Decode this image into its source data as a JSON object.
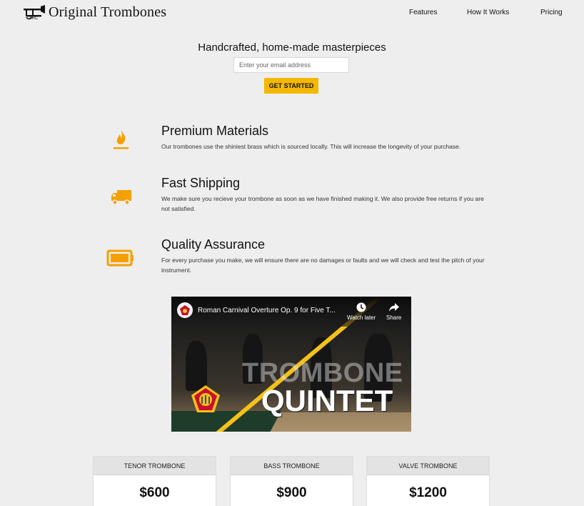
{
  "brand": {
    "name": "Original Trombones",
    "logo_icon": "trombone-icon"
  },
  "nav": {
    "features": "Features",
    "how": "How It Works",
    "pricing": "Pricing"
  },
  "hero": {
    "title": "Handcrafted, home-made masterpieces",
    "email_placeholder": "Enter your email address",
    "cta": "GET STARTED"
  },
  "features": [
    {
      "icon": "fire-icon",
      "title": "Premium Materials",
      "desc": "Our trombones use the shiniest brass which is sourced locally. This will increase the longevity of your purchase."
    },
    {
      "icon": "truck-icon",
      "title": "Fast Shipping",
      "desc": "We make sure you recieve your trombone as soon as we have finished making it. We also provide free returns if you are not satisfied."
    },
    {
      "icon": "battery-icon",
      "title": "Quality Assurance",
      "desc": "For every purchase you make, we will ensure there are no damages or faults and we will check and test the pitch of your instrument."
    }
  ],
  "video": {
    "title": "Roman Carnival Overture Op. 9 for Five T...",
    "watch_later": "Watch later",
    "share": "Share",
    "overlay_top": "TROMBONE",
    "overlay_bottom": "QUINTET"
  },
  "pricing": [
    {
      "name": "TENOR TROMBONE",
      "price": "$600"
    },
    {
      "name": "BASS TROMBONE",
      "price": "$900"
    },
    {
      "name": "VALVE TROMBONE",
      "price": "$1200"
    }
  ],
  "colors": {
    "accent": "#f5b800",
    "background": "#eeeeee"
  }
}
